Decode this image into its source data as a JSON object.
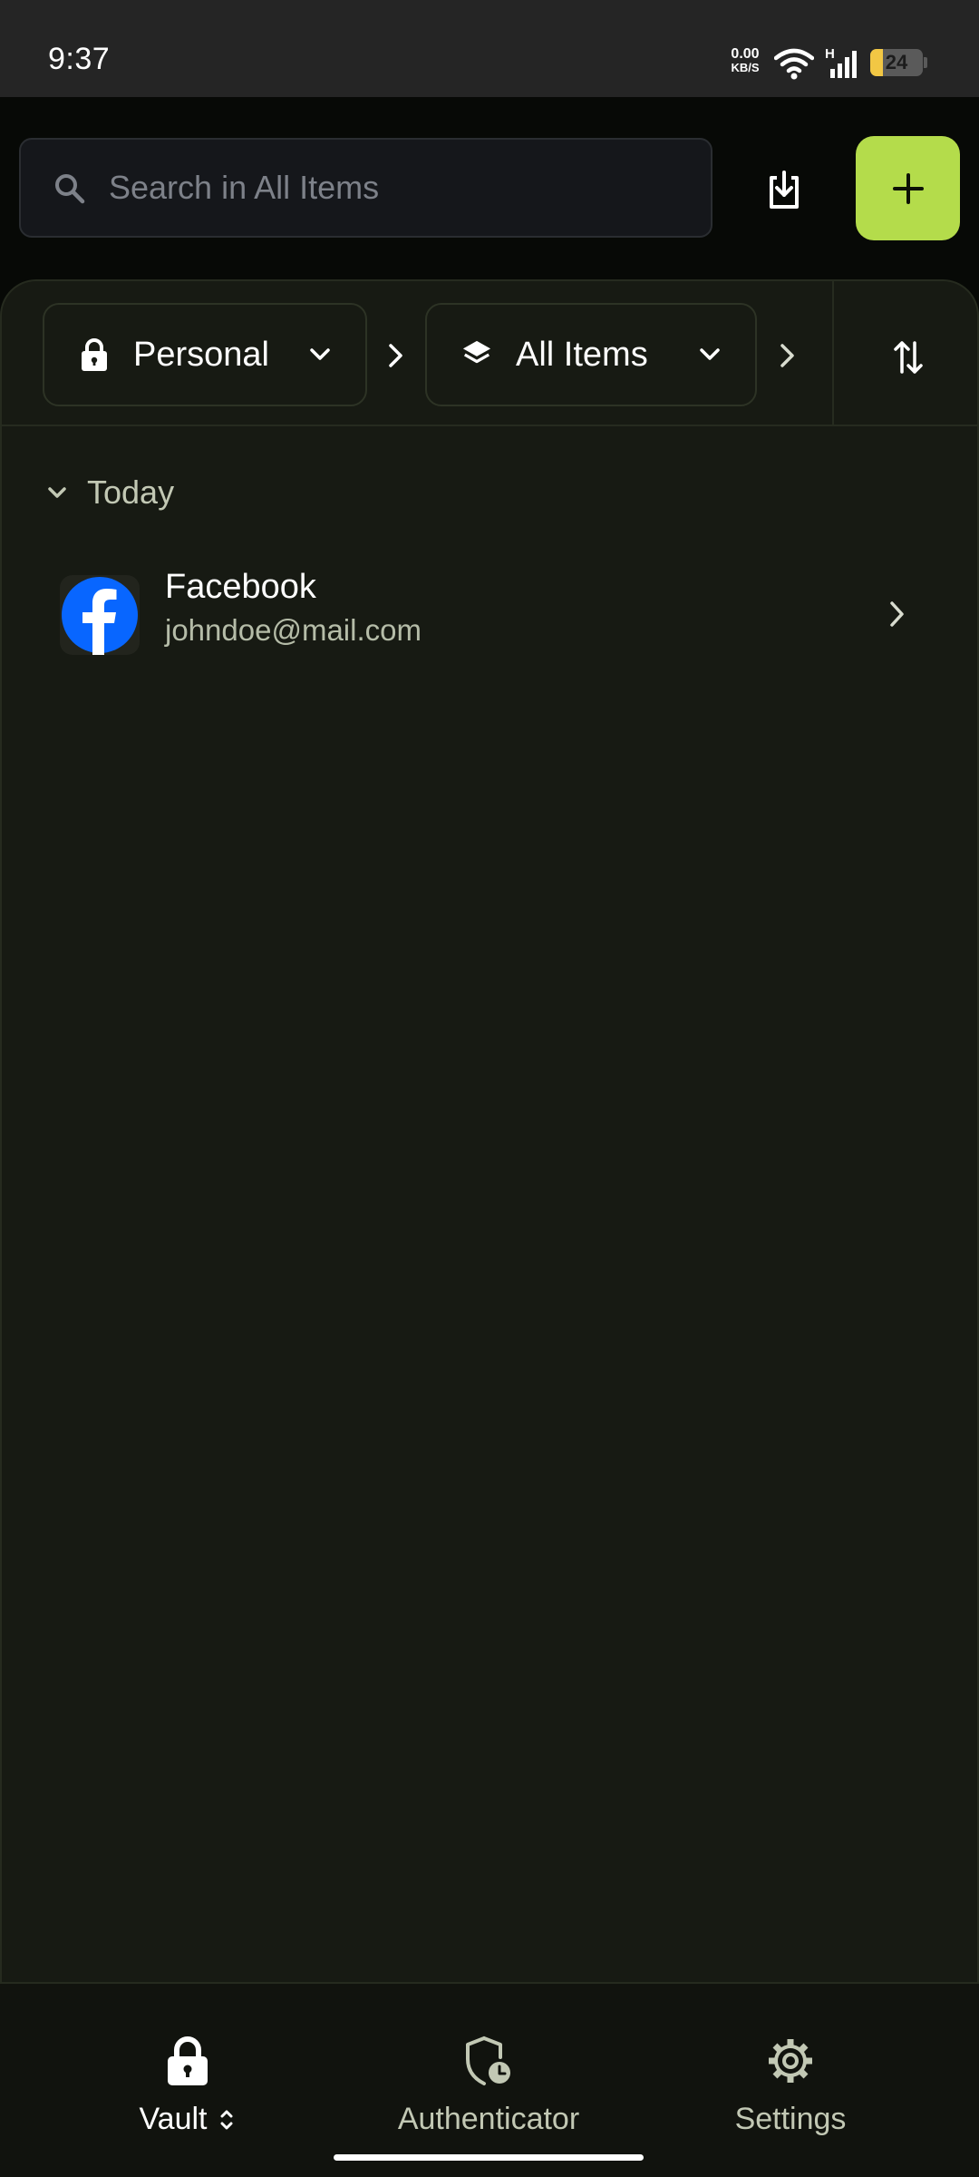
{
  "status_bar": {
    "time": "9:37",
    "net_speed_value": "0.00",
    "net_speed_unit": "KB/S",
    "network_type": "H",
    "battery_level": "24",
    "battery_color": "#f2c744"
  },
  "top_bar": {
    "search_placeholder": "Search in All Items",
    "search_value": "",
    "import_icon": "download-icon",
    "add_icon": "plus-icon",
    "accent_color": "#b4dc4b"
  },
  "filters": {
    "vault": {
      "label": "Personal",
      "icon": "lock-icon"
    },
    "item_type": {
      "label": "All Items",
      "icon": "layers-icon"
    },
    "sort_icon": "sort-arrows-icon"
  },
  "list": {
    "section_label": "Today",
    "items": [
      {
        "title": "Facebook",
        "subtitle": "johndoe@mail.com",
        "icon": "facebook-logo",
        "icon_color": "#0866ff"
      }
    ]
  },
  "bottom_nav": {
    "items": [
      {
        "label": "Vault",
        "icon": "lock-icon",
        "active": true
      },
      {
        "label": "Authenticator",
        "icon": "shield-clock-icon",
        "active": false
      },
      {
        "label": "Settings",
        "icon": "gear-icon",
        "active": false
      }
    ]
  }
}
